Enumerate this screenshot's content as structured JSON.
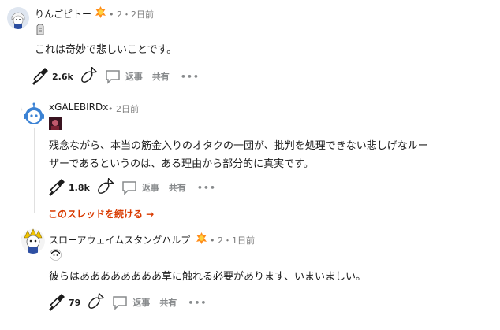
{
  "comments": [
    {
      "username": "りんごピトー",
      "meta": "• 2・2日前",
      "text": "これは奇妙で悲しいことです。",
      "upvotes": "2.6k",
      "reply_label": "返事",
      "share_label": "共有",
      "more_label": "•••"
    },
    {
      "username": "xGALEBIRDx",
      "meta": "• 2日前",
      "text_line1": "残念ながら、本当の筋金入りのオタクの一団が、批判を処理できない悲しげなルー",
      "text_line2": "ザーであるというのは、ある理由から部分的に真実です。",
      "upvotes": "1.8k",
      "reply_label": "返事",
      "share_label": "共有",
      "more_label": "•••"
    },
    {
      "username": "スローアウェイムスタングハルプ",
      "meta": "• 2・1日前",
      "text": "彼らはああああああああ草に触れる必要があります、いまいましい。",
      "upvotes": "79",
      "reply_label": "返事",
      "share_label": "共有",
      "more_label": "•••"
    }
  ],
  "continue_thread": "このスレッドを続ける →",
  "colors": {
    "link": "#d93a00",
    "muted": "#878a8c",
    "thread_line": "#e0e0e0"
  }
}
